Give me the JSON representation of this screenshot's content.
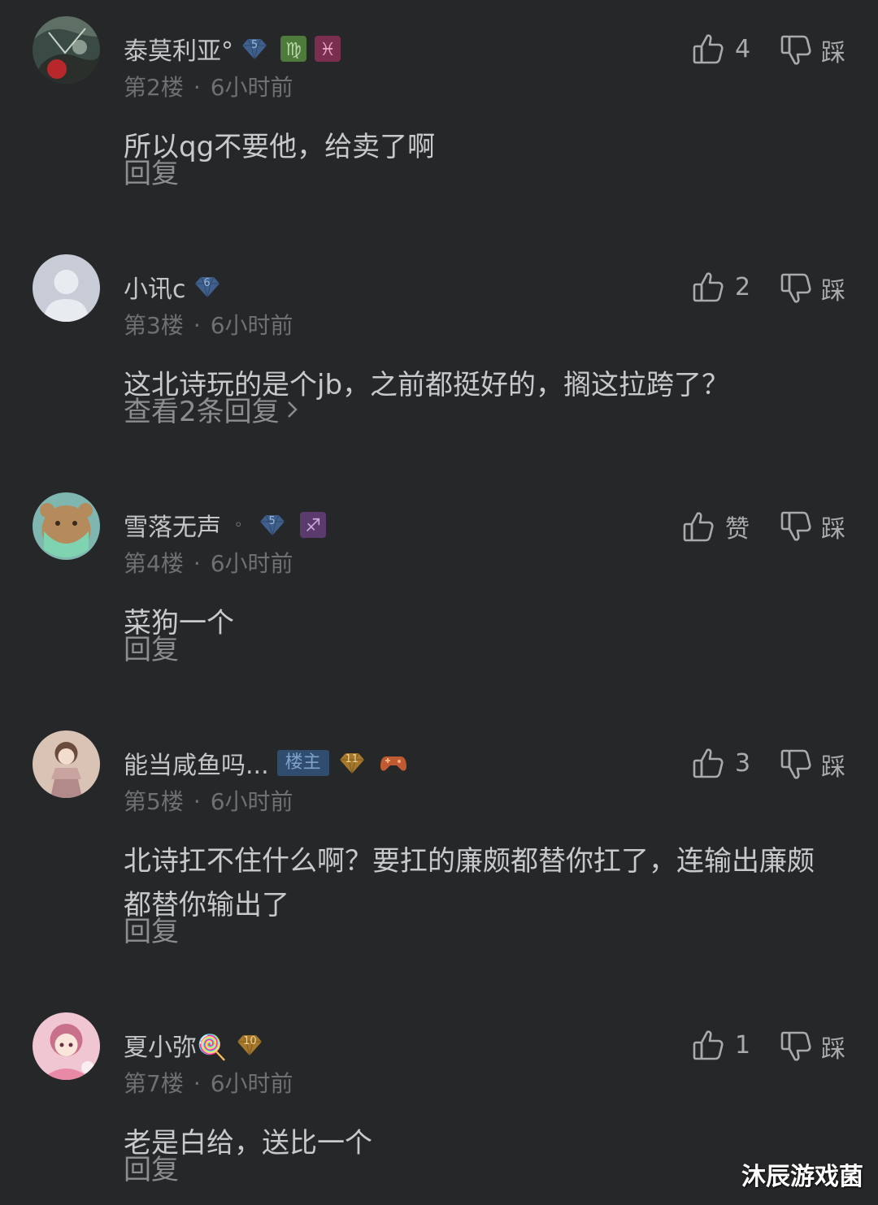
{
  "comments": [
    {
      "name": "泰莫利亚°",
      "level": "5",
      "floor": "第2楼",
      "time": "6小时前",
      "text": "所以qg不要他，给卖了啊",
      "reply_label": "回复",
      "likes": "4",
      "dislike_label": "踩"
    },
    {
      "name": "小讯c",
      "level": "6",
      "floor": "第3楼",
      "time": "6小时前",
      "text": "这北诗玩的是个jb，之前都挺好的，搁这拉跨了？",
      "reply_label": "查看2条回复",
      "likes": "2",
      "dislike_label": "踩"
    },
    {
      "name": "雪落无声",
      "level": "5",
      "floor": "第4楼",
      "time": "6小时前",
      "text": "菜狗一个",
      "reply_label": "回复",
      "likes": "赞",
      "dislike_label": "踩"
    },
    {
      "name": "能当咸鱼吗...",
      "tag": "楼主",
      "level": "11",
      "floor": "第5楼",
      "time": "6小时前",
      "text": "北诗扛不住什么啊？要扛的廉颇都替你扛了，连输出廉颇都替你输出了",
      "reply_label": "回复",
      "likes": "3",
      "dislike_label": "踩"
    },
    {
      "name": "夏小弥🍭",
      "level": "10",
      "floor": "第7楼",
      "time": "6小时前",
      "text": "老是白给，送比一个",
      "reply_label": "回复",
      "likes": "1",
      "dislike_label": "踩"
    }
  ],
  "meta_separator": "·",
  "dot_symbol": "◦",
  "watermark": "沐辰游戏菌",
  "colors": {
    "background": "#262729",
    "text_main": "#c8c9cb",
    "text_meta": "#6f7073",
    "tag_bg": "#304c6e"
  },
  "icons": {
    "like": "thumbs-up-icon",
    "dislike": "thumbs-down-icon",
    "virgo": "virgo-sign-icon",
    "pisces": "pisces-sign-icon",
    "sagittarius": "sagittarius-sign-icon",
    "gamepad": "gamepad-icon"
  }
}
